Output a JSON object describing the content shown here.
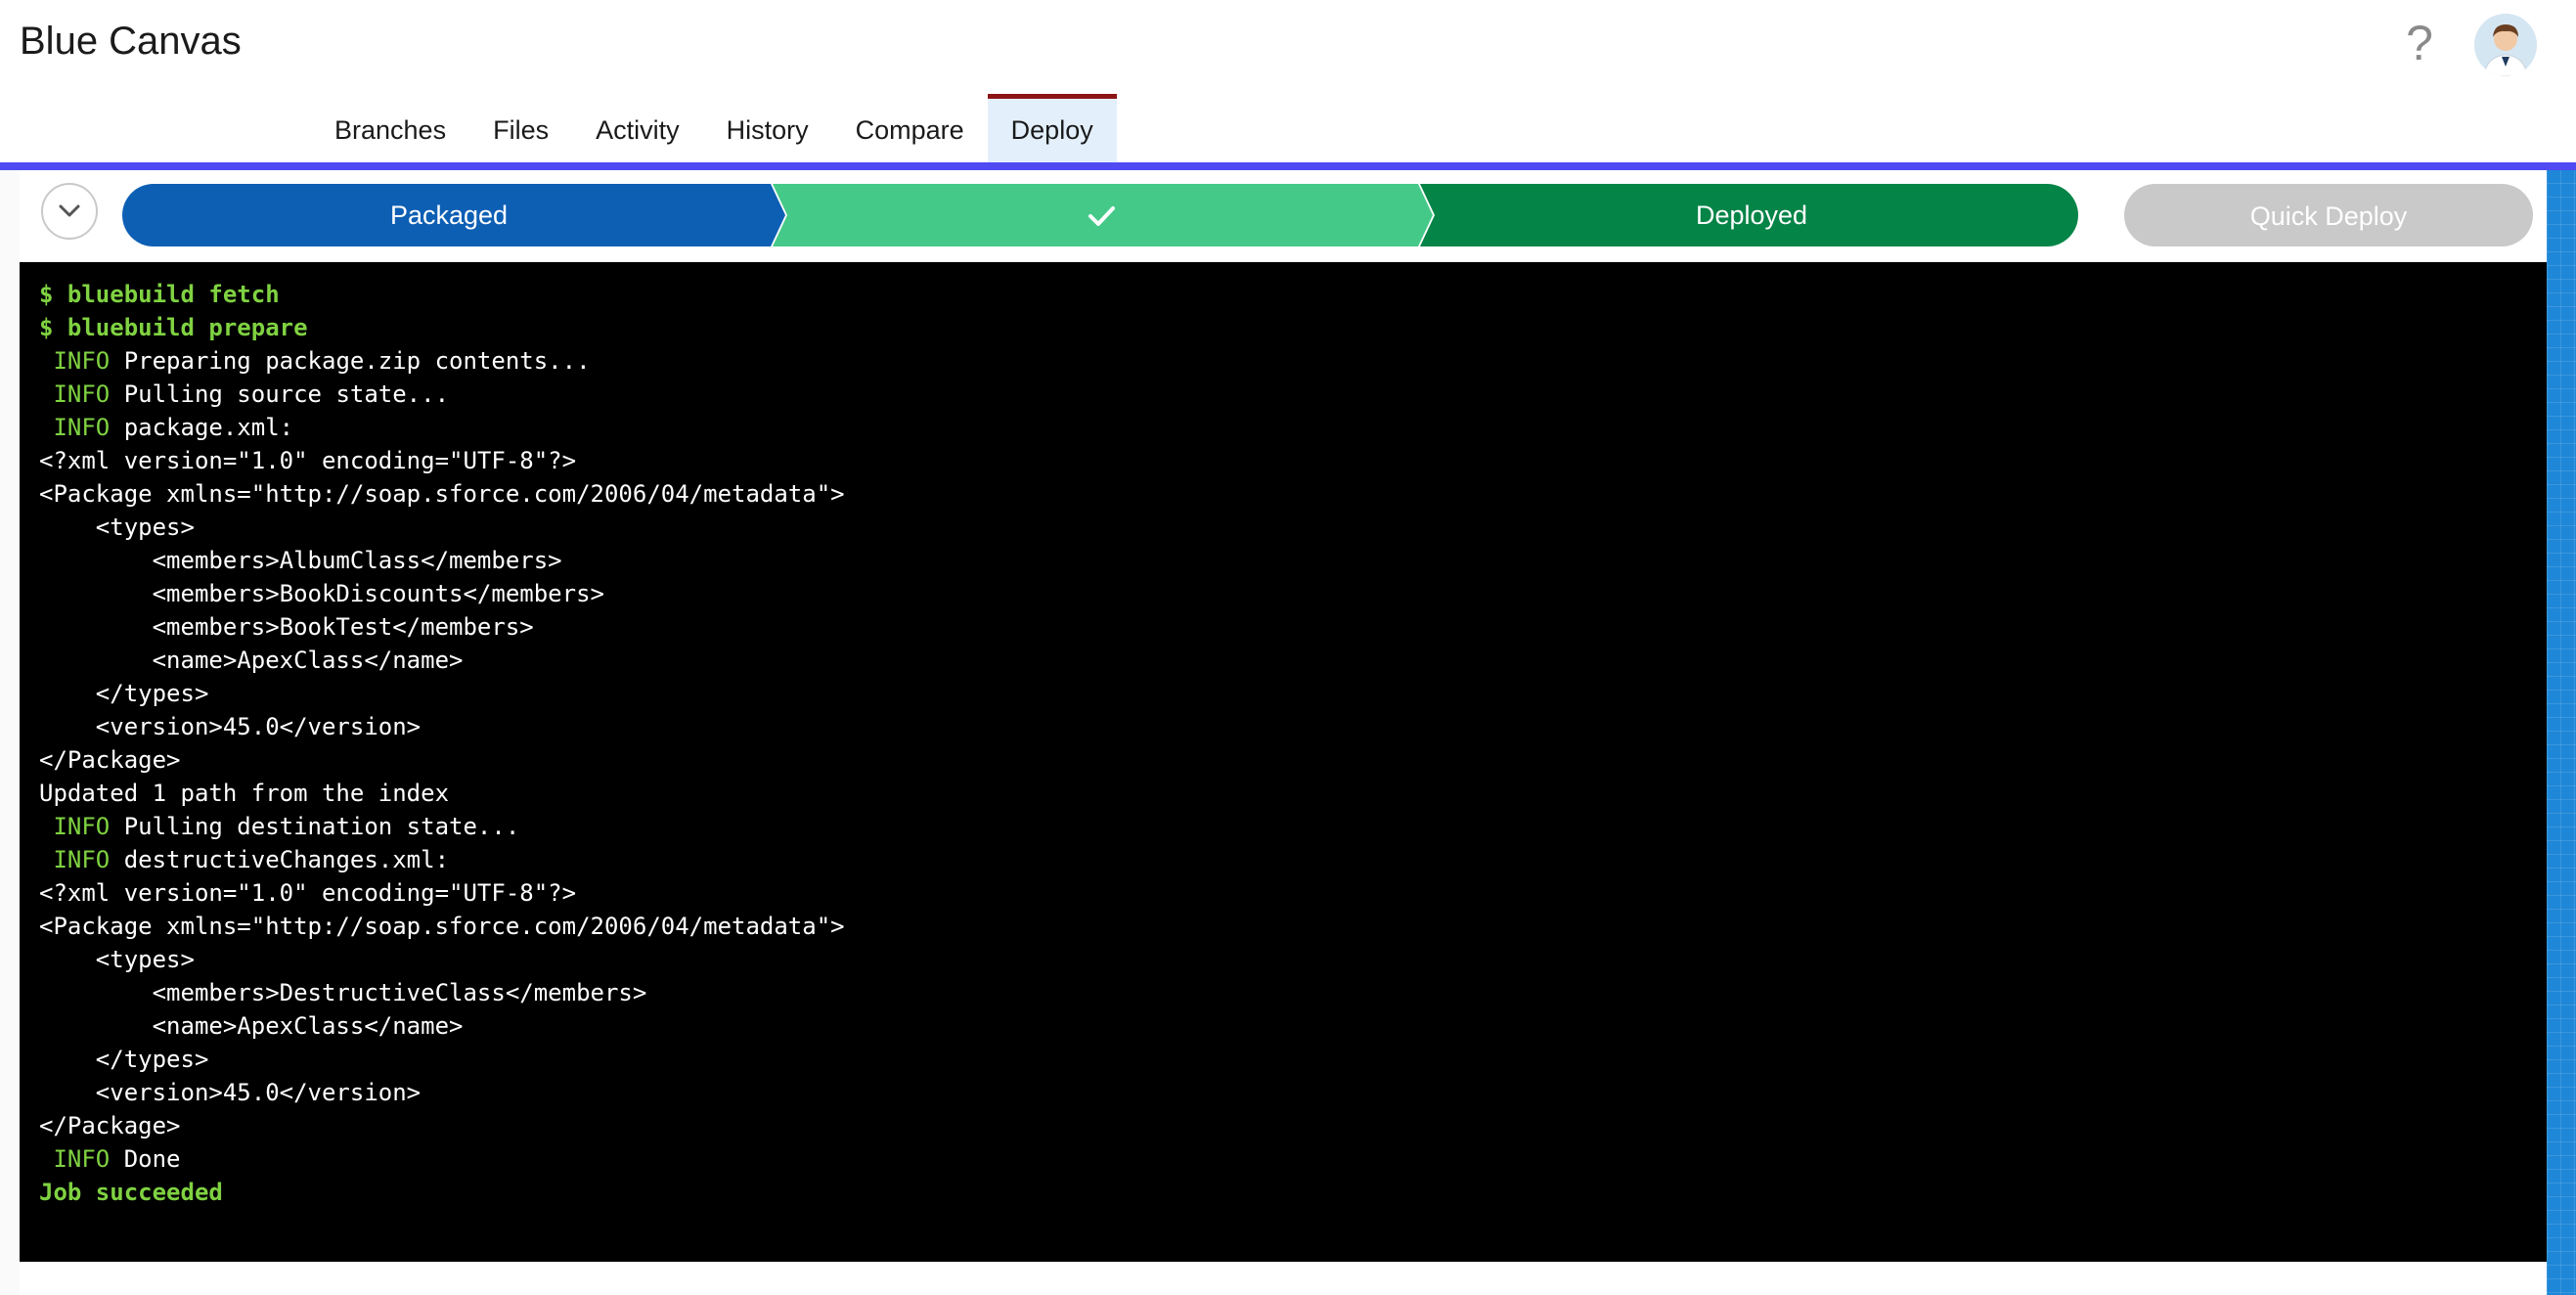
{
  "app": {
    "title": "Blue Canvas"
  },
  "header": {
    "help_icon": "question-mark-icon",
    "avatar_icon": "user-avatar-icon",
    "help_glyph": "?"
  },
  "tabs": [
    {
      "label": "Branches"
    },
    {
      "label": "Files"
    },
    {
      "label": "Activity"
    },
    {
      "label": "History"
    },
    {
      "label": "Compare"
    },
    {
      "label": "Deploy",
      "active": true
    }
  ],
  "deploy_path": {
    "steps": [
      {
        "label": "Packaged",
        "color": "#0d5fb4",
        "state": "complete"
      },
      {
        "label": "",
        "icon": "checkmark-icon",
        "color": "#44c988",
        "state": "complete"
      },
      {
        "label": "Deployed",
        "color": "#048447",
        "state": "current"
      }
    ],
    "quick_deploy_label": "Quick Deploy",
    "collapse_icon": "chevron-down-icon"
  },
  "colors": {
    "accent_rule": "#4f4af2",
    "active_tab_border": "#8b1515",
    "terminal_bg": "#000000",
    "terminal_green": "#7fd241"
  },
  "terminal": {
    "lines": [
      {
        "type": "cmd",
        "text": "$ bluebuild fetch"
      },
      {
        "type": "cmd",
        "text": "$ bluebuild prepare"
      },
      {
        "type": "info",
        "tag": " INFO",
        "text": " Preparing package.zip contents..."
      },
      {
        "type": "info",
        "tag": " INFO",
        "text": " Pulling source state..."
      },
      {
        "type": "info",
        "tag": " INFO",
        "text": " package.xml:"
      },
      {
        "type": "plain",
        "text": "<?xml version=\"1.0\" encoding=\"UTF-8\"?>"
      },
      {
        "type": "plain",
        "text": "<Package xmlns=\"http://soap.sforce.com/2006/04/metadata\">"
      },
      {
        "type": "plain",
        "text": "    <types>"
      },
      {
        "type": "plain",
        "text": "        <members>AlbumClass</members>"
      },
      {
        "type": "plain",
        "text": "        <members>BookDiscounts</members>"
      },
      {
        "type": "plain",
        "text": "        <members>BookTest</members>"
      },
      {
        "type": "plain",
        "text": "        <name>ApexClass</name>"
      },
      {
        "type": "plain",
        "text": "    </types>"
      },
      {
        "type": "plain",
        "text": "    <version>45.0</version>"
      },
      {
        "type": "plain",
        "text": "</Package>"
      },
      {
        "type": "plain",
        "text": "Updated 1 path from the index"
      },
      {
        "type": "info",
        "tag": " INFO",
        "text": " Pulling destination state..."
      },
      {
        "type": "info",
        "tag": " INFO",
        "text": " destructiveChanges.xml:"
      },
      {
        "type": "plain",
        "text": "<?xml version=\"1.0\" encoding=\"UTF-8\"?>"
      },
      {
        "type": "plain",
        "text": "<Package xmlns=\"http://soap.sforce.com/2006/04/metadata\">"
      },
      {
        "type": "plain",
        "text": "    <types>"
      },
      {
        "type": "plain",
        "text": "        <members>DestructiveClass</members>"
      },
      {
        "type": "plain",
        "text": "        <name>ApexClass</name>"
      },
      {
        "type": "plain",
        "text": "    </types>"
      },
      {
        "type": "plain",
        "text": "    <version>45.0</version>"
      },
      {
        "type": "plain",
        "text": "</Package>"
      },
      {
        "type": "info",
        "tag": " INFO",
        "text": " Done"
      },
      {
        "type": "ok",
        "text": "Job succeeded"
      }
    ]
  }
}
